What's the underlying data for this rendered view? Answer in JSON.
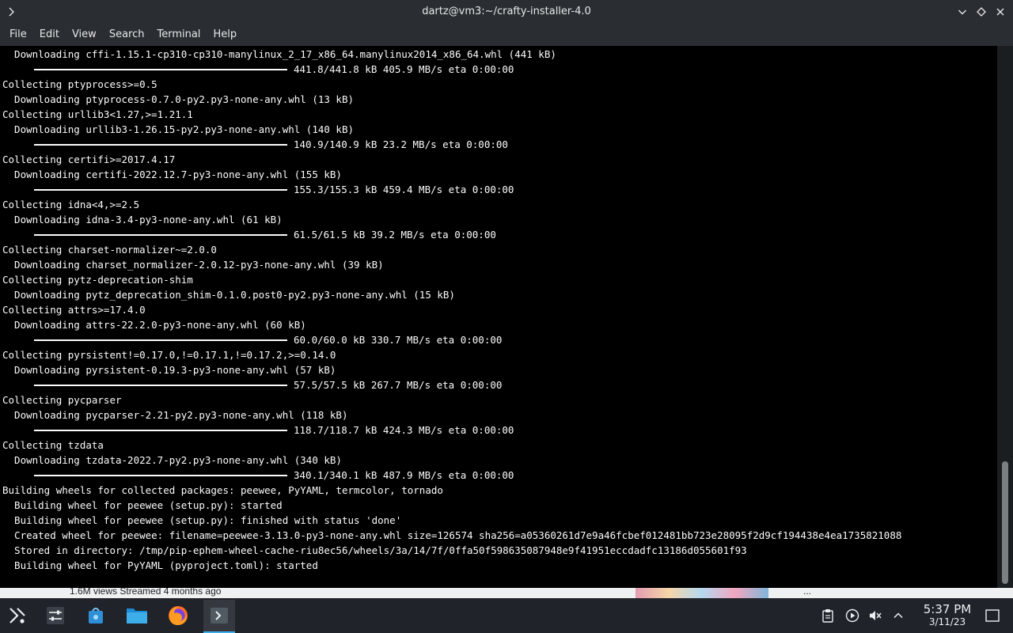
{
  "window": {
    "title": "dartz@vm3:~/crafty-installer-4.0"
  },
  "menu": [
    "File",
    "Edit",
    "View",
    "Search",
    "Terminal",
    "Help"
  ],
  "terminal_lines": [
    {
      "type": "text",
      "text": "  Downloading cffi-1.15.1-cp310-cp310-manylinux_2_17_x86_64.manylinux2014_x86_64.whl (441 kB)"
    },
    {
      "type": "progress",
      "text": "441.8/441.8 kB 405.9 MB/s eta 0:00:00"
    },
    {
      "type": "text",
      "text": "Collecting ptyprocess>=0.5"
    },
    {
      "type": "text",
      "text": "  Downloading ptyprocess-0.7.0-py2.py3-none-any.whl (13 kB)"
    },
    {
      "type": "text",
      "text": "Collecting urllib3<1.27,>=1.21.1"
    },
    {
      "type": "text",
      "text": "  Downloading urllib3-1.26.15-py2.py3-none-any.whl (140 kB)"
    },
    {
      "type": "progress",
      "text": "140.9/140.9 kB 23.2 MB/s eta 0:00:00"
    },
    {
      "type": "text",
      "text": "Collecting certifi>=2017.4.17"
    },
    {
      "type": "text",
      "text": "  Downloading certifi-2022.12.7-py3-none-any.whl (155 kB)"
    },
    {
      "type": "progress",
      "text": "155.3/155.3 kB 459.4 MB/s eta 0:00:00"
    },
    {
      "type": "text",
      "text": "Collecting idna<4,>=2.5"
    },
    {
      "type": "text",
      "text": "  Downloading idna-3.4-py3-none-any.whl (61 kB)"
    },
    {
      "type": "progress",
      "text": "61.5/61.5 kB 39.2 MB/s eta 0:00:00"
    },
    {
      "type": "text",
      "text": "Collecting charset-normalizer~=2.0.0"
    },
    {
      "type": "text",
      "text": "  Downloading charset_normalizer-2.0.12-py3-none-any.whl (39 kB)"
    },
    {
      "type": "text",
      "text": "Collecting pytz-deprecation-shim"
    },
    {
      "type": "text",
      "text": "  Downloading pytz_deprecation_shim-0.1.0.post0-py2.py3-none-any.whl (15 kB)"
    },
    {
      "type": "text",
      "text": "Collecting attrs>=17.4.0"
    },
    {
      "type": "text",
      "text": "  Downloading attrs-22.2.0-py3-none-any.whl (60 kB)"
    },
    {
      "type": "progress",
      "text": "60.0/60.0 kB 330.7 MB/s eta 0:00:00"
    },
    {
      "type": "text",
      "text": "Collecting pyrsistent!=0.17.0,!=0.17.1,!=0.17.2,>=0.14.0"
    },
    {
      "type": "text",
      "text": "  Downloading pyrsistent-0.19.3-py3-none-any.whl (57 kB)"
    },
    {
      "type": "progress",
      "text": "57.5/57.5 kB 267.7 MB/s eta 0:00:00"
    },
    {
      "type": "text",
      "text": "Collecting pycparser"
    },
    {
      "type": "text",
      "text": "  Downloading pycparser-2.21-py2.py3-none-any.whl (118 kB)"
    },
    {
      "type": "progress",
      "text": "118.7/118.7 kB 424.3 MB/s eta 0:00:00"
    },
    {
      "type": "text",
      "text": "Collecting tzdata"
    },
    {
      "type": "text",
      "text": "  Downloading tzdata-2022.7-py2.py3-none-any.whl (340 kB)"
    },
    {
      "type": "progress",
      "text": "340.1/340.1 kB 487.9 MB/s eta 0:00:00"
    },
    {
      "type": "text",
      "text": "Building wheels for collected packages: peewee, PyYAML, termcolor, tornado"
    },
    {
      "type": "text",
      "text": "  Building wheel for peewee (setup.py): started"
    },
    {
      "type": "text",
      "text": "  Building wheel for peewee (setup.py): finished with status 'done'"
    },
    {
      "type": "text",
      "text": "  Created wheel for peewee: filename=peewee-3.13.0-py3-none-any.whl size=126574 sha256=a05360261d7e9a46fcbef012481bb723e28095f2d9cf194438e4ea1735821088"
    },
    {
      "type": "text",
      "text": "  Stored in directory: /tmp/pip-ephem-wheel-cache-riu8ec56/wheels/3a/14/7f/0ffa50f598635087948e9f41951eccdadfc13186d055601f93"
    },
    {
      "type": "text",
      "text": "  Building wheel for PyYAML (pyproject.toml): started"
    }
  ],
  "background_window": {
    "left_text": "1.6M views  Streamed 4 months ago",
    "right_text": "..."
  },
  "taskbar": {
    "apps": [
      {
        "name": "application-launcher-icon"
      },
      {
        "name": "mixer-settings-icon"
      },
      {
        "name": "discover-store-icon"
      },
      {
        "name": "file-manager-icon"
      },
      {
        "name": "firefox-icon"
      },
      {
        "name": "konsole-terminal-icon"
      }
    ],
    "time": "5:37 PM",
    "date": "3/11/23"
  },
  "colors": {
    "titlebar_bg": "#2a2e32",
    "terminal_bg": "#000000",
    "terminal_fg": "#fcfcfc",
    "taskbar_bg": "#20232a",
    "accent": "#3daee9"
  }
}
